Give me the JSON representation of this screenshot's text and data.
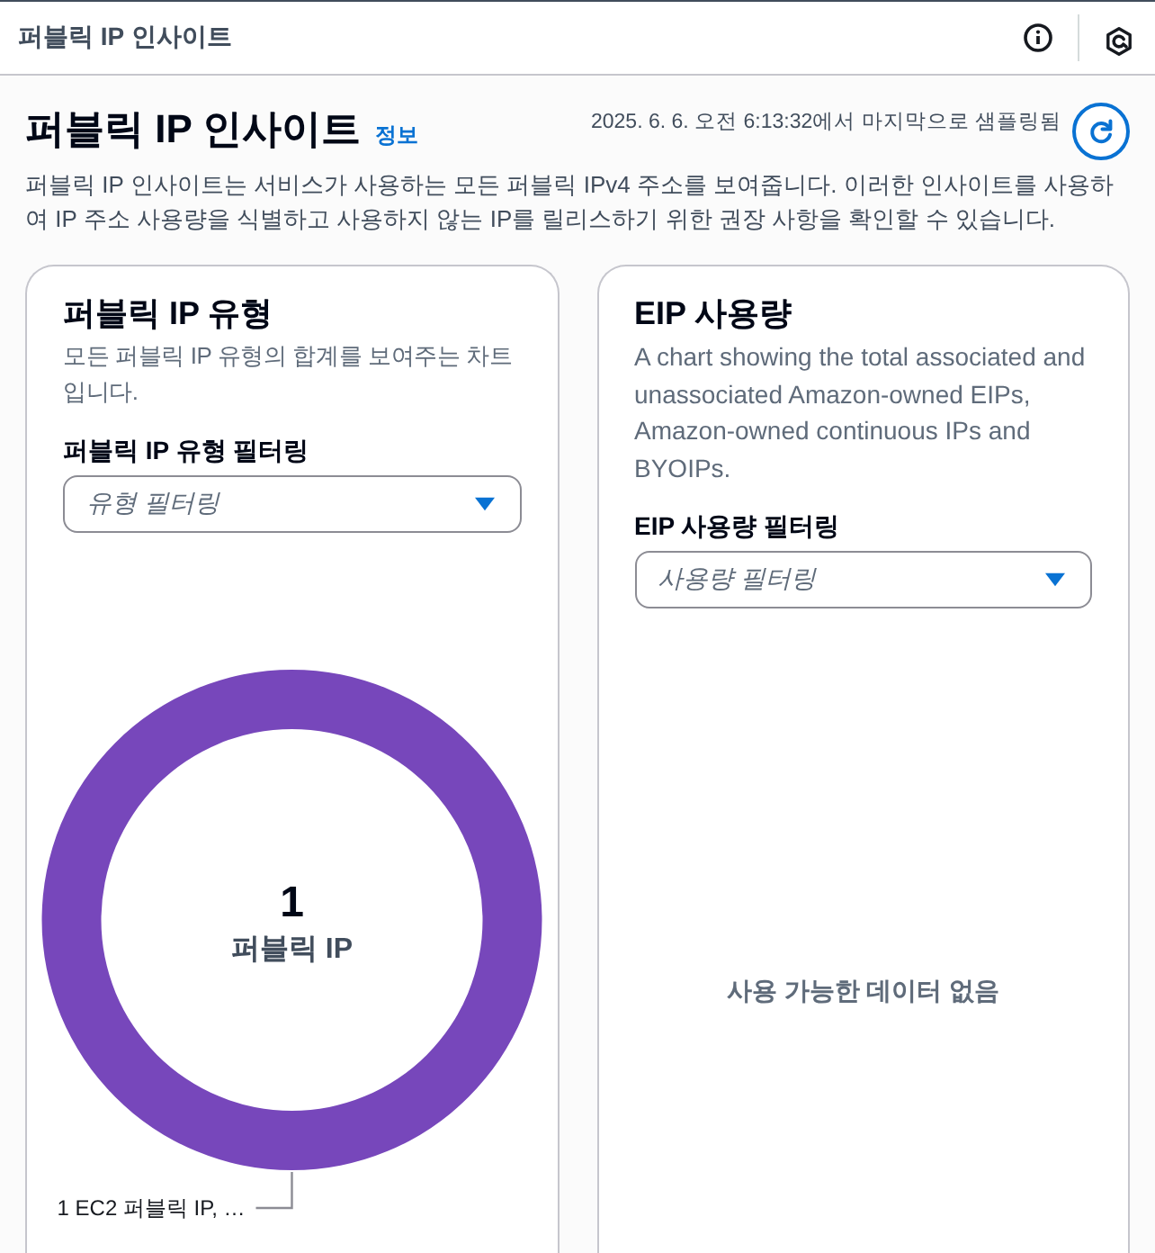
{
  "top_bar": {
    "title": "퍼블릭 IP 인사이트"
  },
  "header": {
    "title": "퍼블릭 IP 인사이트",
    "info_link": "정보",
    "last_sampled": "2025. 6. 6. 오전 6:13:32에서 마지막으로 샘플링됨",
    "description": "퍼블릭 IP 인사이트는 서비스가 사용하는 모든 퍼블릭 IPv4 주소를 보여줍니다. 이러한 인사이트를 사용하여 IP 주소 사용량을 식별하고 사용하지 않는 IP를 릴리스하기 위한 권장 사항을 확인할 수 있습니다."
  },
  "panels": [
    {
      "kind": "chart",
      "title": "퍼블릭 IP 유형",
      "description": "모든 퍼블릭 IP 유형의 합계를 보여주는 차트입니다.",
      "filter": {
        "label": "퍼블릭 IP 유형 필터링",
        "placeholder": "유형 필터링"
      },
      "center_value": "1",
      "center_label": "퍼블릭 IP",
      "segment_label": "1 EC2 퍼블릭 IP, …"
    },
    {
      "kind": "empty",
      "title": "EIP 사용량",
      "description": "A chart showing the total associated and unassociated Amazon-owned EIPs, Amazon-owned continuous IPs and BYOIPs.",
      "filter": {
        "label": "EIP 사용량 필터링",
        "placeholder": "사용량 필터링"
      },
      "empty_message": "사용 가능한 데이터 없음"
    }
  ]
}
